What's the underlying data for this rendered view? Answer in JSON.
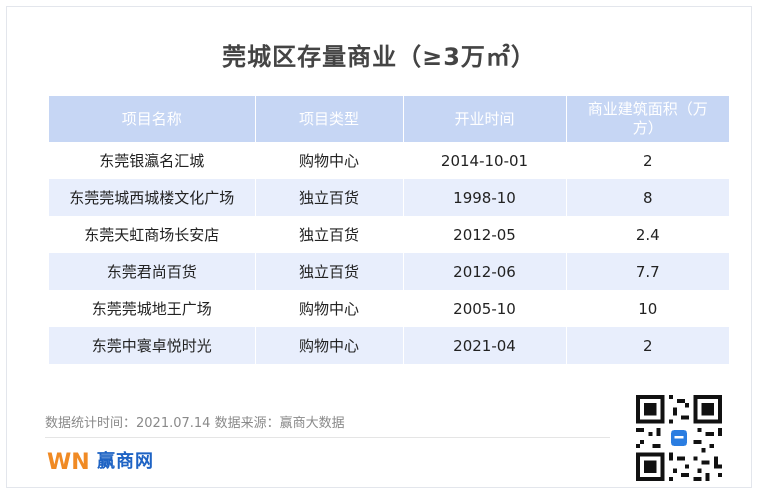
{
  "title": "莞城区存量商业（≥3万㎡）",
  "table": {
    "headers": [
      "项目名称",
      "项目类型",
      "开业时间",
      "商业建筑面积（万方）"
    ],
    "rows": [
      [
        "东莞银瀛名汇城",
        "购物中心",
        "2014-10-01",
        "2"
      ],
      [
        "东莞莞城西城楼文化广场",
        "独立百货",
        "1998-10",
        "8"
      ],
      [
        "东莞天虹商场长安店",
        "独立百货",
        "2012-05",
        "2.4"
      ],
      [
        "东莞君尚百货",
        "独立百货",
        "2012-06",
        "7.7"
      ],
      [
        "东莞莞城地王广场",
        "购物中心",
        "2005-10",
        "10"
      ],
      [
        "东莞中寰卓悦时光",
        "购物中心",
        "2021-04",
        "2"
      ]
    ]
  },
  "footer": {
    "note": "数据统计时间：2021.07.14  数据来源：赢商大数据",
    "brand_name": "赢商网",
    "brand_mark": "WN"
  },
  "colors": {
    "header_bg": "#c6d6f4",
    "alt_row_bg": "#e8eefc",
    "brand_blue": "#1e63c4",
    "brand_orange": "#f08a24"
  },
  "icons": [
    "winshang-logo-icon",
    "qr-code-icon"
  ]
}
